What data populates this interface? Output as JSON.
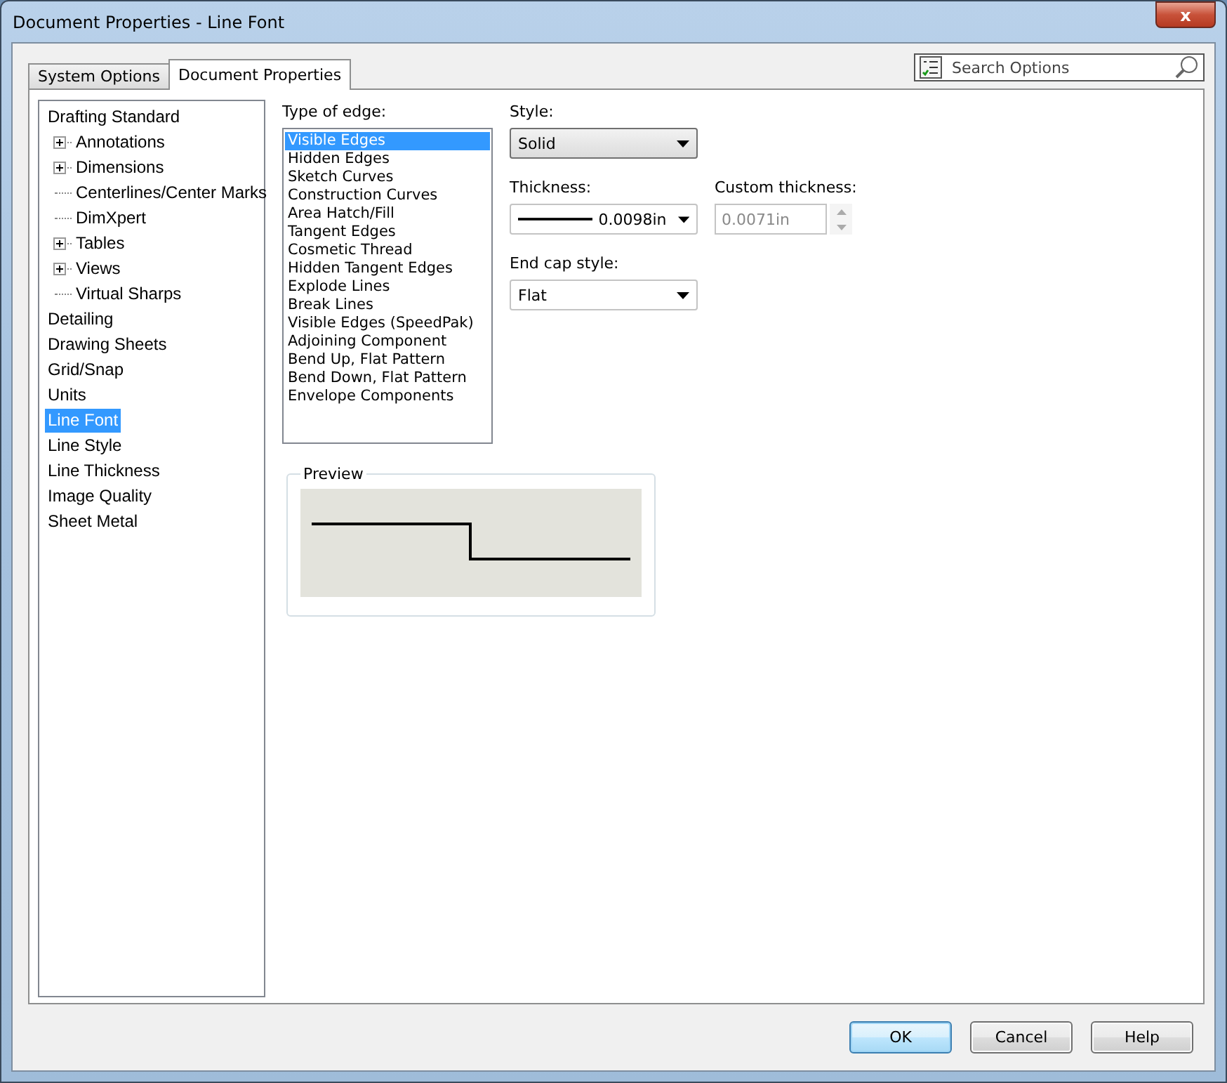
{
  "window": {
    "title": "Document Properties - Line Font",
    "close_label": "x"
  },
  "tabs": [
    {
      "label": "System Options",
      "selected": false
    },
    {
      "label": "Document Properties",
      "selected": true
    }
  ],
  "search": {
    "placeholder": "Search Options"
  },
  "tree": [
    {
      "label": "Drafting Standard",
      "selected": false,
      "children": [
        {
          "label": "Annotations",
          "selected": false,
          "expanded": false
        },
        {
          "label": "Dimensions",
          "selected": false,
          "expanded": false
        },
        {
          "label": "Centerlines/Center Marks",
          "selected": false
        },
        {
          "label": "DimXpert",
          "selected": false
        },
        {
          "label": "Tables",
          "selected": false,
          "expanded": false
        },
        {
          "label": "Views",
          "selected": false,
          "expanded": false
        },
        {
          "label": "Virtual Sharps",
          "selected": false
        }
      ]
    },
    {
      "label": "Detailing",
      "selected": false
    },
    {
      "label": "Drawing Sheets",
      "selected": false
    },
    {
      "label": "Grid/Snap",
      "selected": false
    },
    {
      "label": "Units",
      "selected": false
    },
    {
      "label": "Line Font",
      "selected": true
    },
    {
      "label": "Line Style",
      "selected": false
    },
    {
      "label": "Line Thickness",
      "selected": false
    },
    {
      "label": "Image Quality",
      "selected": false
    },
    {
      "label": "Sheet Metal",
      "selected": false
    }
  ],
  "edge_types": {
    "label": "Type of edge:",
    "items": [
      {
        "label": "Visible Edges",
        "selected": true
      },
      {
        "label": "Hidden Edges",
        "selected": false
      },
      {
        "label": "Sketch Curves",
        "selected": false
      },
      {
        "label": "Construction Curves",
        "selected": false
      },
      {
        "label": "Area Hatch/Fill",
        "selected": false
      },
      {
        "label": "Tangent Edges",
        "selected": false
      },
      {
        "label": "Cosmetic Thread",
        "selected": false
      },
      {
        "label": "Hidden Tangent Edges",
        "selected": false
      },
      {
        "label": "Explode Lines",
        "selected": false
      },
      {
        "label": "Break Lines",
        "selected": false
      },
      {
        "label": "Visible Edges (SpeedPak)",
        "selected": false
      },
      {
        "label": "Adjoining Component",
        "selected": false
      },
      {
        "label": "Bend Up, Flat Pattern",
        "selected": false
      },
      {
        "label": "Bend Down, Flat Pattern",
        "selected": false
      },
      {
        "label": "Envelope Components",
        "selected": false
      }
    ]
  },
  "style": {
    "label": "Style:",
    "value": "Solid"
  },
  "thickness": {
    "label": "Thickness:",
    "value": "0.0098in"
  },
  "custom_thickness": {
    "label": "Custom thickness:",
    "value": "0.0071in",
    "disabled": true
  },
  "end_cap": {
    "label": "End cap style:",
    "value": "Flat"
  },
  "preview": {
    "label": "Preview"
  },
  "buttons": [
    {
      "label": "OK",
      "default": true
    },
    {
      "label": "Cancel",
      "default": false
    },
    {
      "label": "Help",
      "default": false
    }
  ]
}
